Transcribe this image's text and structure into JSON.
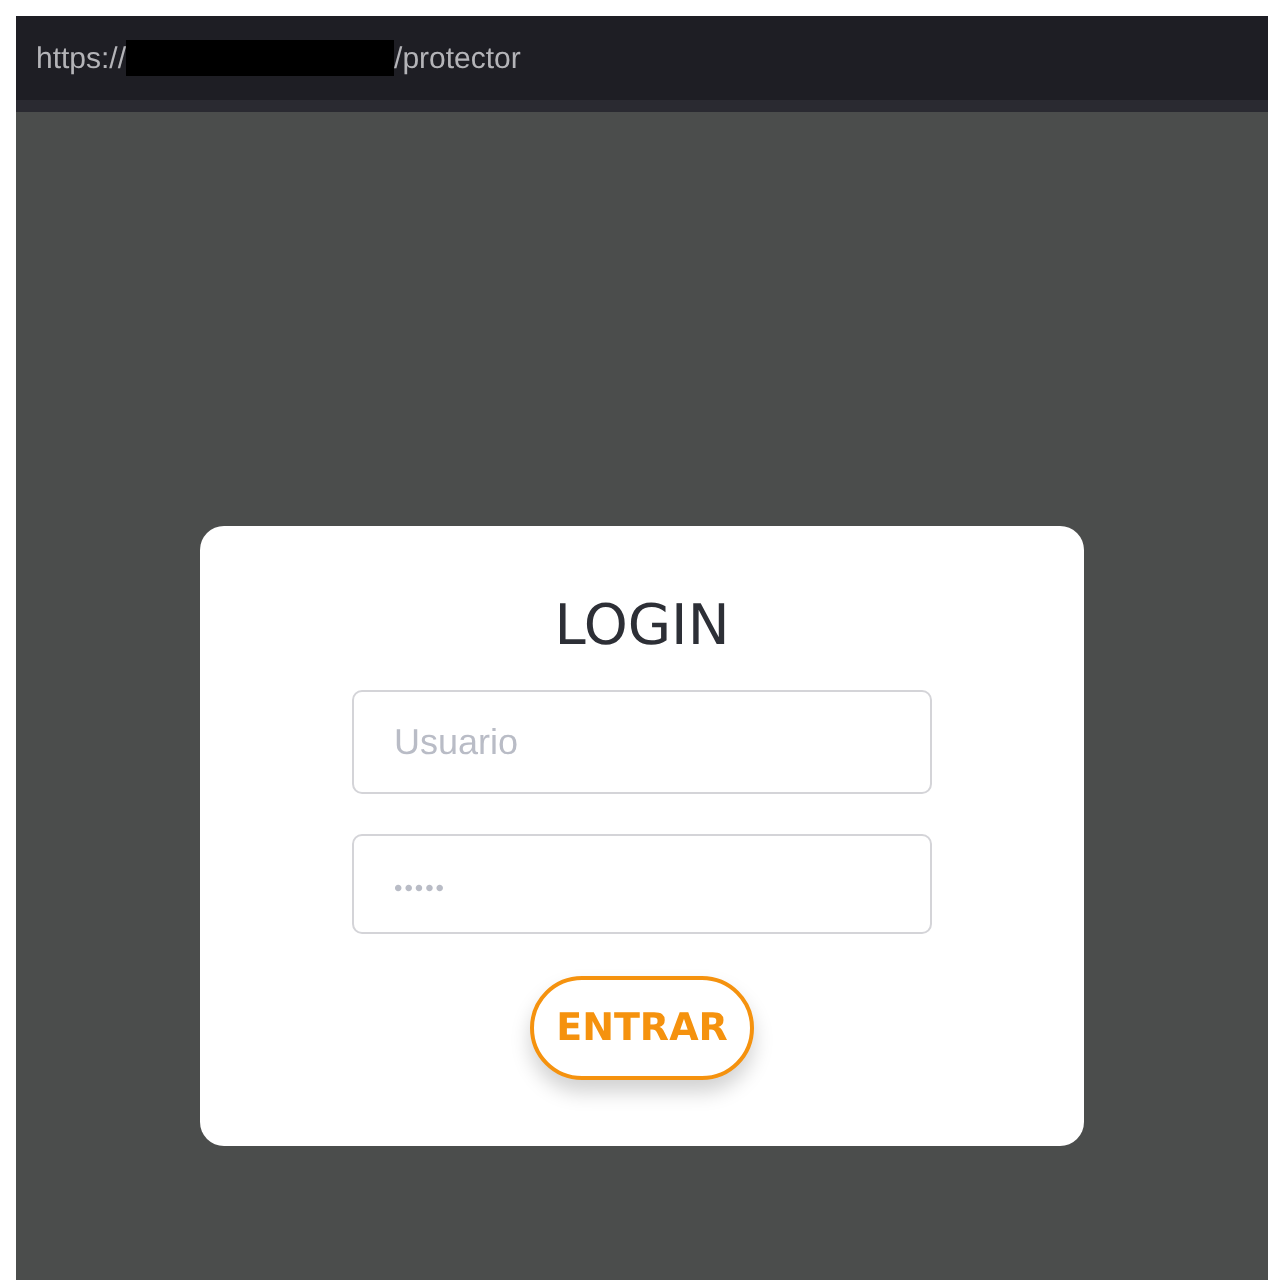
{
  "address_bar": {
    "url_start": "https://",
    "redacted": true,
    "url_end": "/protector"
  },
  "login": {
    "title": "LOGIN",
    "fields": [
      {
        "kind": "text",
        "placeholder": "Usuario"
      },
      {
        "kind": "password",
        "placeholder": "•••••"
      }
    ],
    "button": "ENTRAR"
  }
}
